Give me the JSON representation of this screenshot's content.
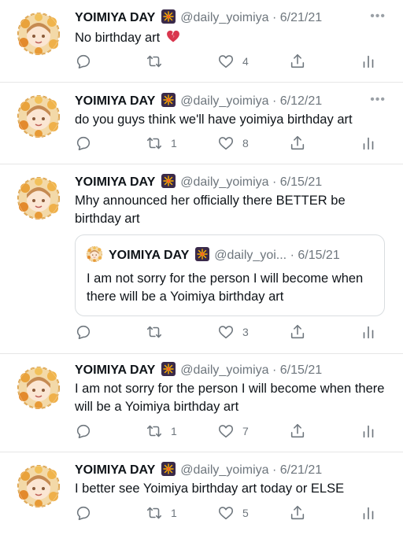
{
  "colors": {
    "text": "#0f1419",
    "secondary": "#6e767d",
    "separator": "#e6e6e6",
    "heart_emoji": "#d9364e"
  },
  "tweets": [
    {
      "name": "YOIMIYA DAY",
      "handle": "@daily_yoimiya",
      "dot": "·",
      "date": "6/21/21",
      "text": "No birthday art",
      "emoji": "broken-heart",
      "counts": {
        "reply": "",
        "retweet": "",
        "like": "4"
      }
    },
    {
      "name": "YOIMIYA DAY",
      "handle": "@daily_yoimiya",
      "dot": "·",
      "date": "6/12/21",
      "text": "do you guys think we'll have yoimiya birthday art",
      "counts": {
        "reply": "",
        "retweet": "1",
        "like": "8"
      }
    },
    {
      "name": "YOIMIYA DAY",
      "handle": "@daily_yoimiya",
      "dot": "·",
      "date": "6/15/21",
      "text": "Mhy announced her officially there BETTER be birthday art",
      "quote": {
        "name": "YOIMIYA DAY",
        "handle": "@daily_yoi...",
        "dot": "·",
        "date": "6/15/21",
        "text": "I am not sorry for the person I will become when there will be a Yoimiya birthday art"
      },
      "counts": {
        "reply": "",
        "retweet": "",
        "like": "3"
      }
    },
    {
      "name": "YOIMIYA DAY",
      "handle": "@daily_yoimiya",
      "dot": "·",
      "date": "6/15/21",
      "text": "I am not sorry for the person I will become when there will be a Yoimiya birthday art",
      "counts": {
        "reply": "",
        "retweet": "1",
        "like": "7"
      }
    },
    {
      "name": "YOIMIYA DAY",
      "handle": "@daily_yoimiya",
      "dot": "·",
      "date": "6/21/21",
      "text": "I better see Yoimiya birthday art today or ELSE",
      "counts": {
        "reply": "",
        "retweet": "1",
        "like": "5"
      }
    }
  ],
  "icons": {
    "avatar": "avatar-image",
    "name_badge": "fireworks-icon",
    "more": "more-options-icon",
    "reply": "reply-icon",
    "retweet": "retweet-icon",
    "like": "like-icon",
    "share": "share-icon",
    "analytics": "analytics-icon"
  },
  "more_glyph": "•••"
}
